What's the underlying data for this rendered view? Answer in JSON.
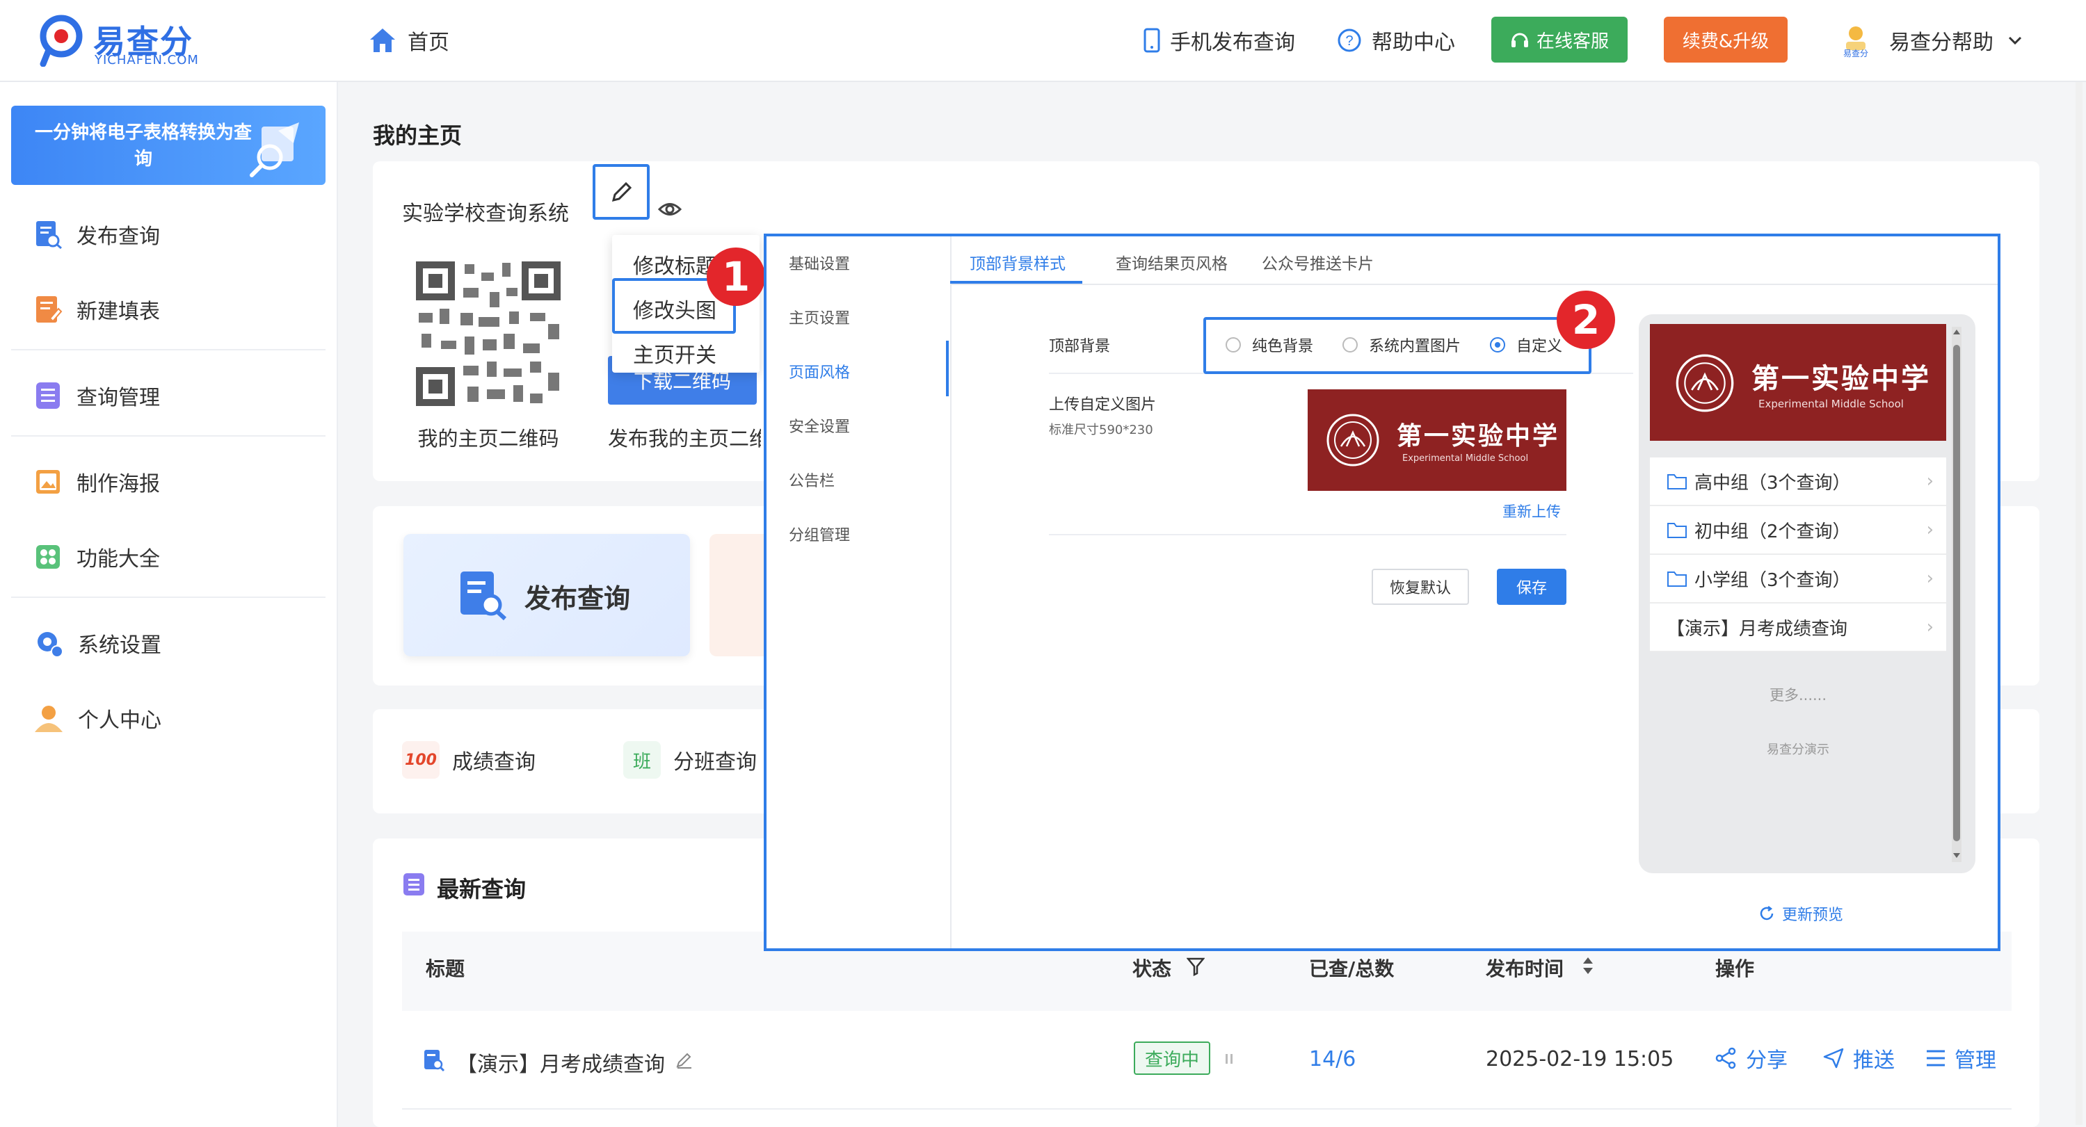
{
  "header": {
    "logo_text": "易查分",
    "logo_sub": "YICHAFEN.COM",
    "home": "首页",
    "mobile_publish": "手机发布查询",
    "help_center": "帮助中心",
    "online_service": "在线客服",
    "renew": "续费&升级",
    "user": "易查分帮助",
    "avatar_label": "易查分"
  },
  "sidebar": {
    "banner": "一分钟将电子表格转换为查询",
    "items": [
      {
        "label": "发布查询",
        "icon": "publish-query-icon"
      },
      {
        "label": "新建填表",
        "icon": "new-form-icon"
      },
      {
        "label": "查询管理",
        "icon": "query-manage-icon"
      },
      {
        "label": "制作海报",
        "icon": "poster-icon"
      },
      {
        "label": "功能大全",
        "icon": "features-icon"
      },
      {
        "label": "系统设置",
        "icon": "settings-icon"
      },
      {
        "label": "个人中心",
        "icon": "user-center-icon"
      }
    ]
  },
  "main": {
    "title": "我的主页",
    "site_name": "实验学校查询系统",
    "qr_label": "我的主页二维码",
    "download_btn": "下载二维码",
    "publish_qr": "发布我的主页二维",
    "menu": [
      "修改标题",
      "修改头图",
      "主页开关"
    ],
    "steps": [
      "1",
      "2"
    ],
    "quick_publish": "发布查询",
    "cat_score": "成绩查询",
    "cat_class": "分班查询",
    "cat_class_badge": "班",
    "cat_score_badge": "100",
    "latest_title": "最新查询"
  },
  "dialog": {
    "left_menu": [
      "基础设置",
      "主页设置",
      "页面风格",
      "安全设置",
      "公告栏",
      "分组管理"
    ],
    "active_left": "页面风格",
    "tabs": [
      "顶部背景样式",
      "查询结果页风格",
      "公众号推送卡片"
    ],
    "bg_label": "顶部背景",
    "options": [
      "纯色背景",
      "系统内置图片",
      "自定义"
    ],
    "selected_option": "自定义",
    "upload_label": "上传自定义图片",
    "upload_hint": "标准尺寸590*230",
    "reupload": "重新上传",
    "reset": "恢复默认",
    "save": "保存",
    "school_cn": "第一实验中学",
    "school_en": "Experimental Middle School",
    "preview_rows": [
      "高中组（3个查询）",
      "初中组（2个查询）",
      "小学组（3个查询）",
      "【演示】月考成绩查询"
    ],
    "more": "更多......",
    "preview_footer": "易查分演示",
    "refresh_preview": "更新预览"
  },
  "table": {
    "headers": [
      "标题",
      "状态",
      "已查/总数",
      "发布时间",
      "操作"
    ],
    "rows": [
      {
        "title": "【演示】月考成绩查询",
        "status": "查询中",
        "count": "14/6",
        "time": "2025-02-19 15:05",
        "actions": [
          "分享",
          "推送",
          "管理"
        ]
      }
    ]
  },
  "colors": {
    "primary": "#2f7de8",
    "green": "#3cab5b",
    "orange": "#ef6f32",
    "badge_red": "#e3262b",
    "school_red": "#8e2222"
  }
}
